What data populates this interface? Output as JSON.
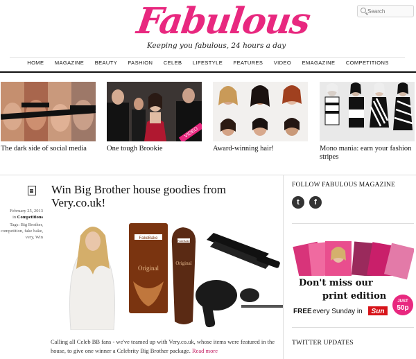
{
  "brand": {
    "logo_text": "Fabulous",
    "tagline": "Keeping you fabulous, 24 hours a day",
    "accent": "#e8287f"
  },
  "search": {
    "placeholder": "Search"
  },
  "nav": [
    "HOME",
    "MAGAZINE",
    "BEAUTY",
    "FASHION",
    "CELEB",
    "LIFESTYLE",
    "FEATURES",
    "VIDEO",
    "EMAGAZINE",
    "COMPETITIONS"
  ],
  "features": [
    {
      "caption": "The dark side of social media"
    },
    {
      "caption": "One tough Brookie",
      "badge": "VIDEO"
    },
    {
      "caption": "Award-winning hair!"
    },
    {
      "caption": "Mono mania: earn your fashion stripes"
    }
  ],
  "post": {
    "date": "February 25, 2013",
    "in_label": "in",
    "category": "Competitions",
    "tags_label": "Tags:",
    "tags": "Big Brother, competition, fake bake, very, Win",
    "title": "Win Big Brother house goodies from Very.co.uk!",
    "excerpt": "Calling all Celeb BB fans - we've teamed up with Very.co.uk, whose items were featured in the house, to give one winner a Celebrity Big Brother package.",
    "read_more": "Read more",
    "product_brand": "FakeBake",
    "product_name": "Original"
  },
  "sidebar": {
    "follow_title": "FOLLOW FABULOUS MAGAZINE",
    "twitter_updates_title": "TWITTER UPDATES",
    "promo": {
      "line1": "Don't miss our",
      "line2": "print edition",
      "line3_free": "FREE",
      "line3_rest": "every Sunday in",
      "paper": "Sun",
      "badge_top": "JUST",
      "badge_price": "50p"
    }
  }
}
